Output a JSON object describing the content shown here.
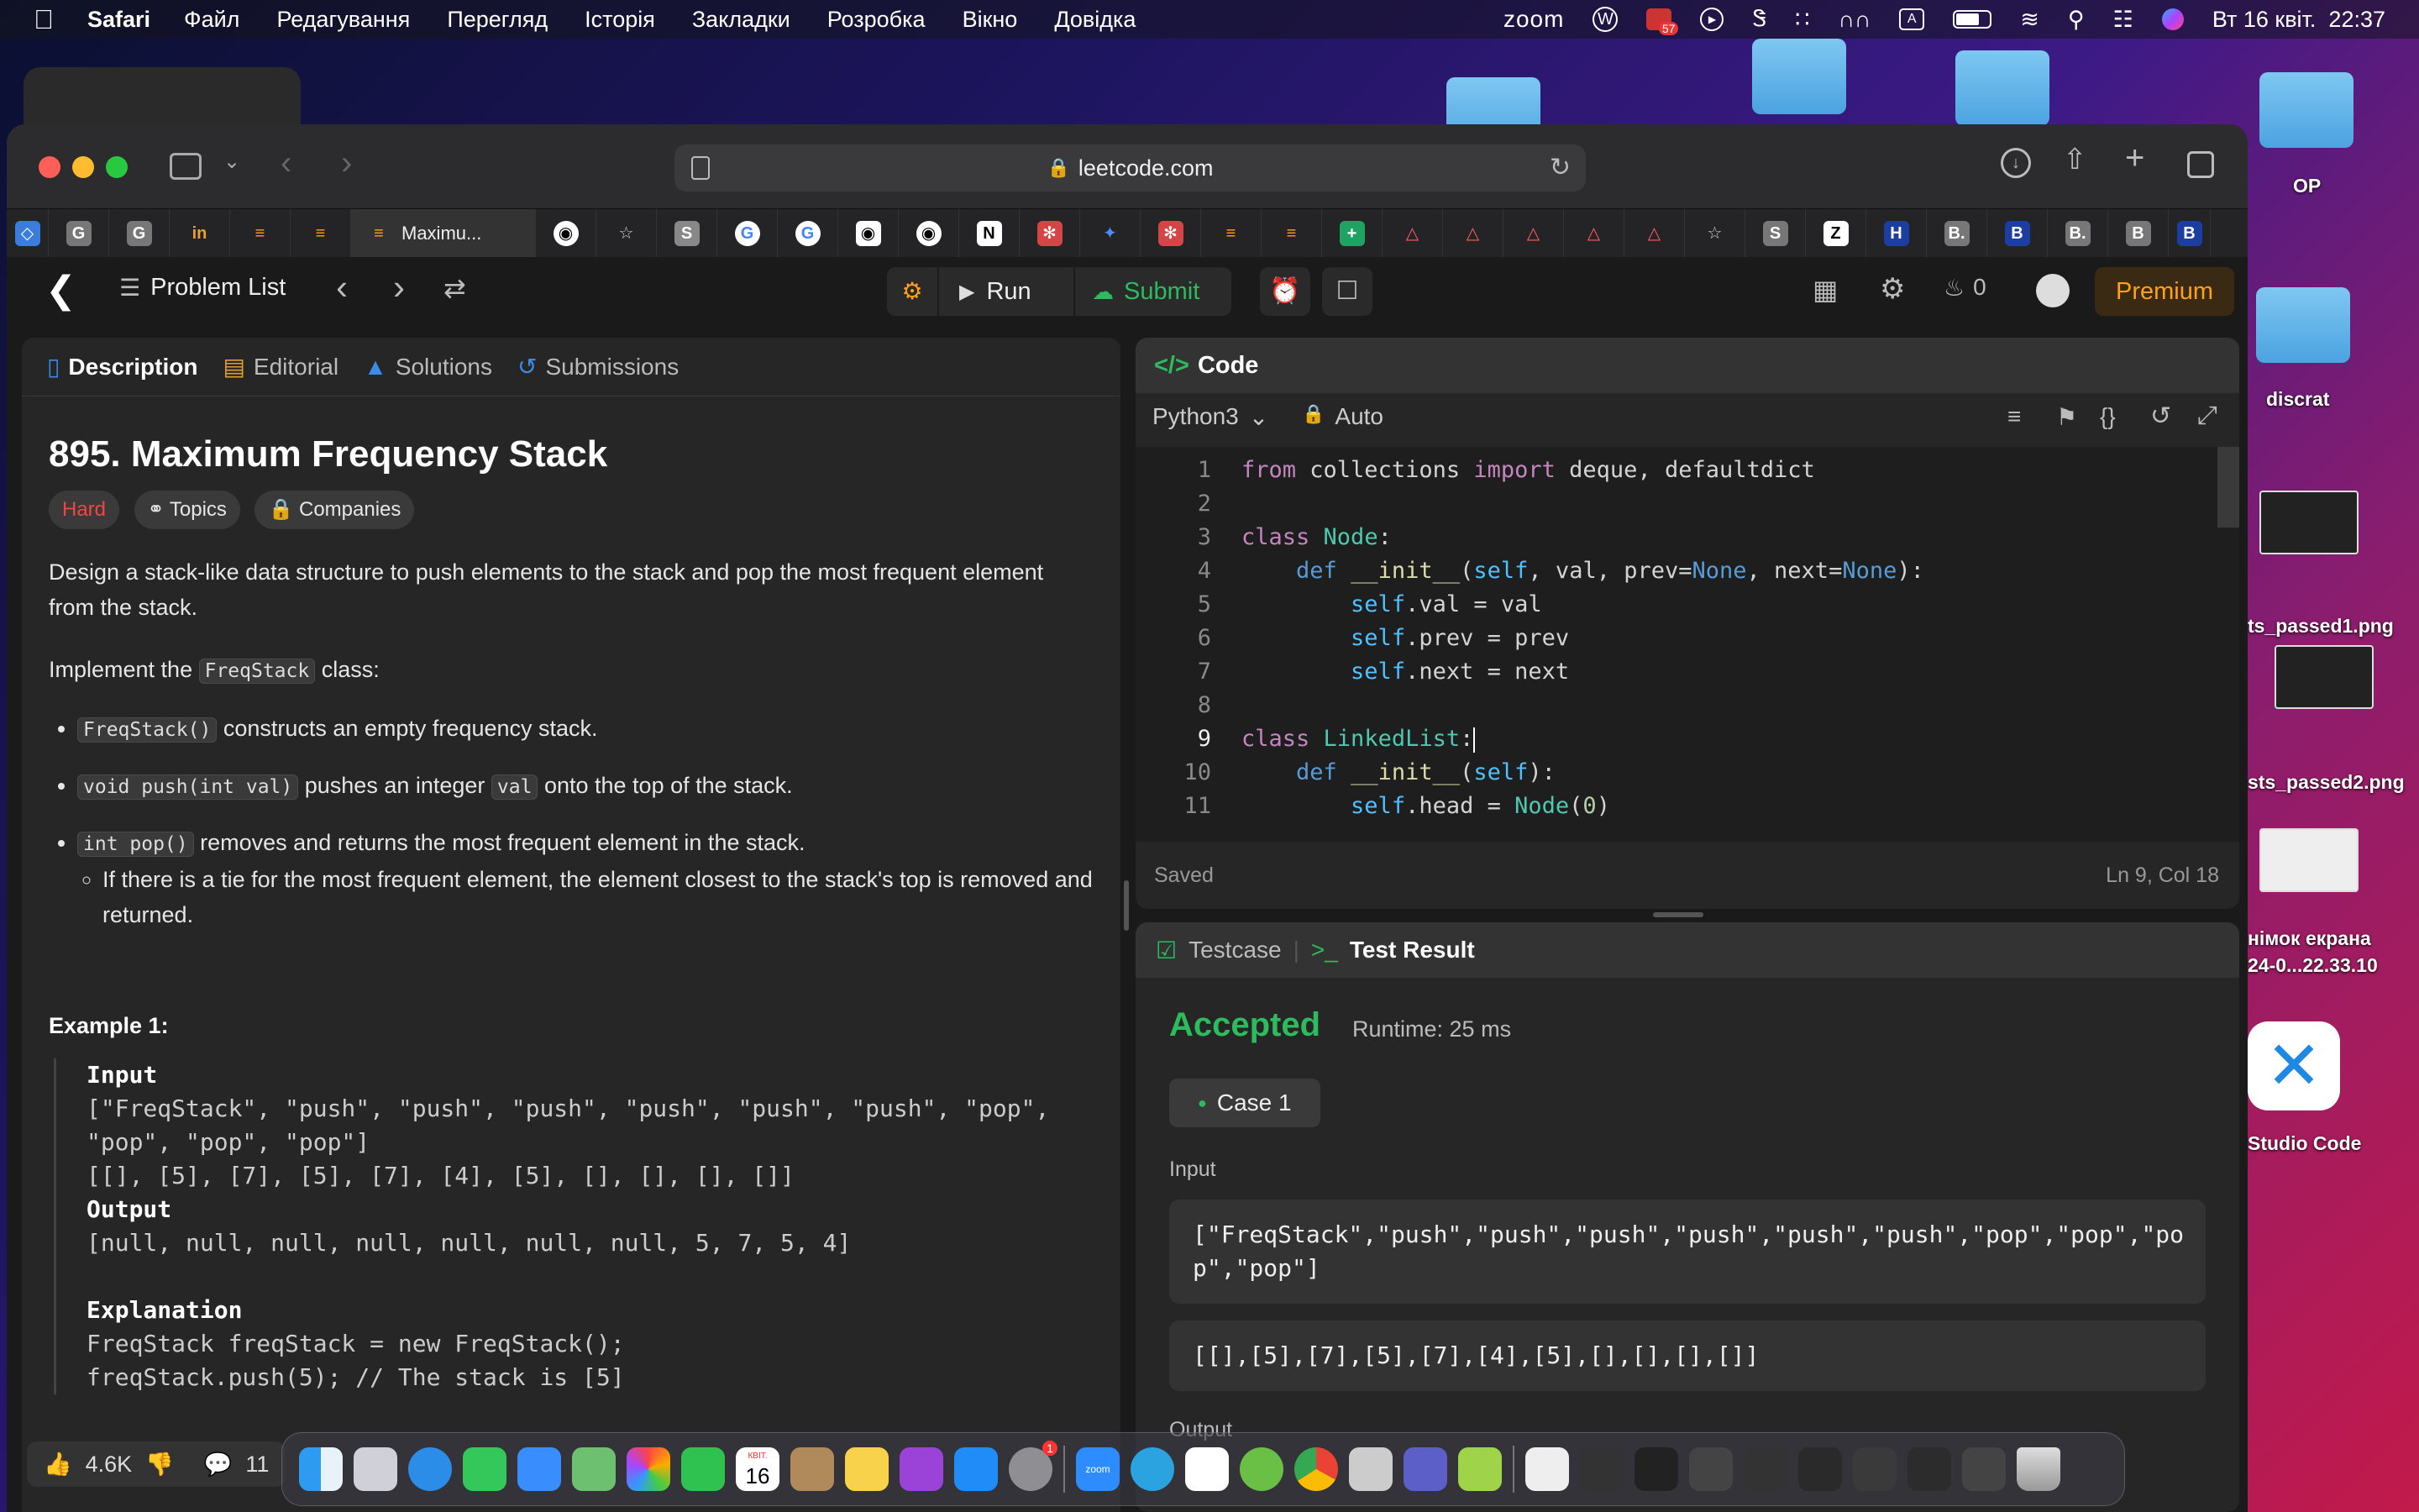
{
  "menubar": {
    "app": "Safari",
    "items": [
      "Файл",
      "Редагування",
      "Перегляд",
      "Історія",
      "Закладки",
      "Розробка",
      "Вікно",
      "Довідка"
    ],
    "zoom": "zoom",
    "badge": "57",
    "input_indicator": "A",
    "clock": "Вт 16 квіт.  22:37"
  },
  "desktop": {
    "items": [
      {
        "label": "OP"
      },
      {
        "label": "discrat"
      },
      {
        "label": "ts_passed1.png"
      },
      {
        "label": "sts_passed2.png"
      },
      {
        "label": "німок екрана"
      },
      {
        "label": "24-0...22.33.10"
      },
      {
        "label": "Studio Code"
      }
    ]
  },
  "browser": {
    "url": "leetcode.com",
    "active_tab": "Maximu...",
    "tab_letters": [
      "G",
      "G",
      "in",
      "S",
      "Z",
      "H",
      "B.",
      "B",
      "B.",
      "B",
      "B",
      "B."
    ]
  },
  "leetcode": {
    "problem_list": "Problem List",
    "run": "Run",
    "submit": "Submit",
    "streak": "0",
    "premium": "Premium",
    "tabs": {
      "description": "Description",
      "editorial": "Editorial",
      "solutions": "Solutions",
      "submissions": "Submissions"
    },
    "title": "895. Maximum Frequency Stack",
    "difficulty": "Hard",
    "topics": "Topics",
    "companies": "Companies",
    "desc_p1": "Design a stack-like data structure to push elements to the stack and pop the most frequent element from the stack.",
    "impl_pre": "Implement the ",
    "impl_code": "FreqStack",
    "impl_post": " class:",
    "b1_code": "FreqStack()",
    "b1_text": " constructs an empty frequency stack.",
    "b2_code": "void push(int val)",
    "b2_text1": " pushes an integer ",
    "b2_code2": "val",
    "b2_text2": " onto the top of the stack.",
    "b3_code": "int pop()",
    "b3_text": " removes and returns the most frequent element in the stack.",
    "b3_sub": "If there is a tie for the most frequent element, the element closest to the stack's top is removed and returned.",
    "example_title": "Example 1:",
    "ex_input_label": "Input",
    "ex_input_1": "[\"FreqStack\", \"push\", \"push\", \"push\", \"push\", \"push\", \"push\", \"pop\",",
    "ex_input_2": "\"pop\", \"pop\", \"pop\"]",
    "ex_input_3": "[[], [5], [7], [5], [7], [4], [5], [], [], [], []]",
    "ex_output_label": "Output",
    "ex_output": "[null, null, null, null, null, null, null, 5, 7, 5, 4]",
    "ex_expl_label": "Explanation",
    "ex_expl_1": "FreqStack freqStack = new FreqStack();",
    "ex_expl_2": "freqStack.push(5); // The stack is [5]",
    "likes": "4.6K",
    "comments": "11"
  },
  "code": {
    "header": "Code",
    "language": "Python3",
    "mode": "Auto",
    "saved": "Saved",
    "cursor": "Ln 9, Col 18",
    "line_numbers": [
      "1",
      "2",
      "3",
      "4",
      "5",
      "6",
      "7",
      "8",
      "9",
      "10",
      "11"
    ],
    "tokens": {
      "from": "from",
      "import": "import",
      "l1_mod": " collections ",
      "l1_names": " deque, defaultdict",
      "class": "class",
      "def": "def",
      "node": "Node",
      "colon": ":",
      "init": "__init__",
      "self": "self",
      "l4_args_a": ", val, prev=",
      "none": "None",
      "l4_args_b": ", next=",
      "l4_end": "):",
      "l5_rest": ".val = val",
      "l6_rest": ".prev = prev",
      "l7_rest": ".next = next",
      "linkedlist": "LinkedList",
      "l10_end": "):",
      "paren": "(",
      "l11_a": ".head = ",
      "zero": "0",
      "close": ")"
    }
  },
  "result": {
    "tab_testcase": "Testcase",
    "tab_result": "Test Result",
    "status": "Accepted",
    "runtime": "Runtime: 25 ms",
    "case": "Case 1",
    "input_label": "Input",
    "input_1": "[\"FreqStack\",\"push\",\"push\",\"push\",\"push\",\"push\",\"push\",\"pop\",\"pop\",\"po\np\",\"pop\"]",
    "input_2": "[[],[5],[7],[5],[7],[4],[5],[],[],[],[]]",
    "output_label": "Output"
  },
  "dock": {
    "calendar_month": "КВІТ.",
    "calendar_day": "16",
    "zoom_label": "zoom",
    "badge": "1"
  },
  "colors": {
    "accent_green": "#2cbb5d",
    "hard": "#ef4743",
    "premium": "#ffa116"
  }
}
